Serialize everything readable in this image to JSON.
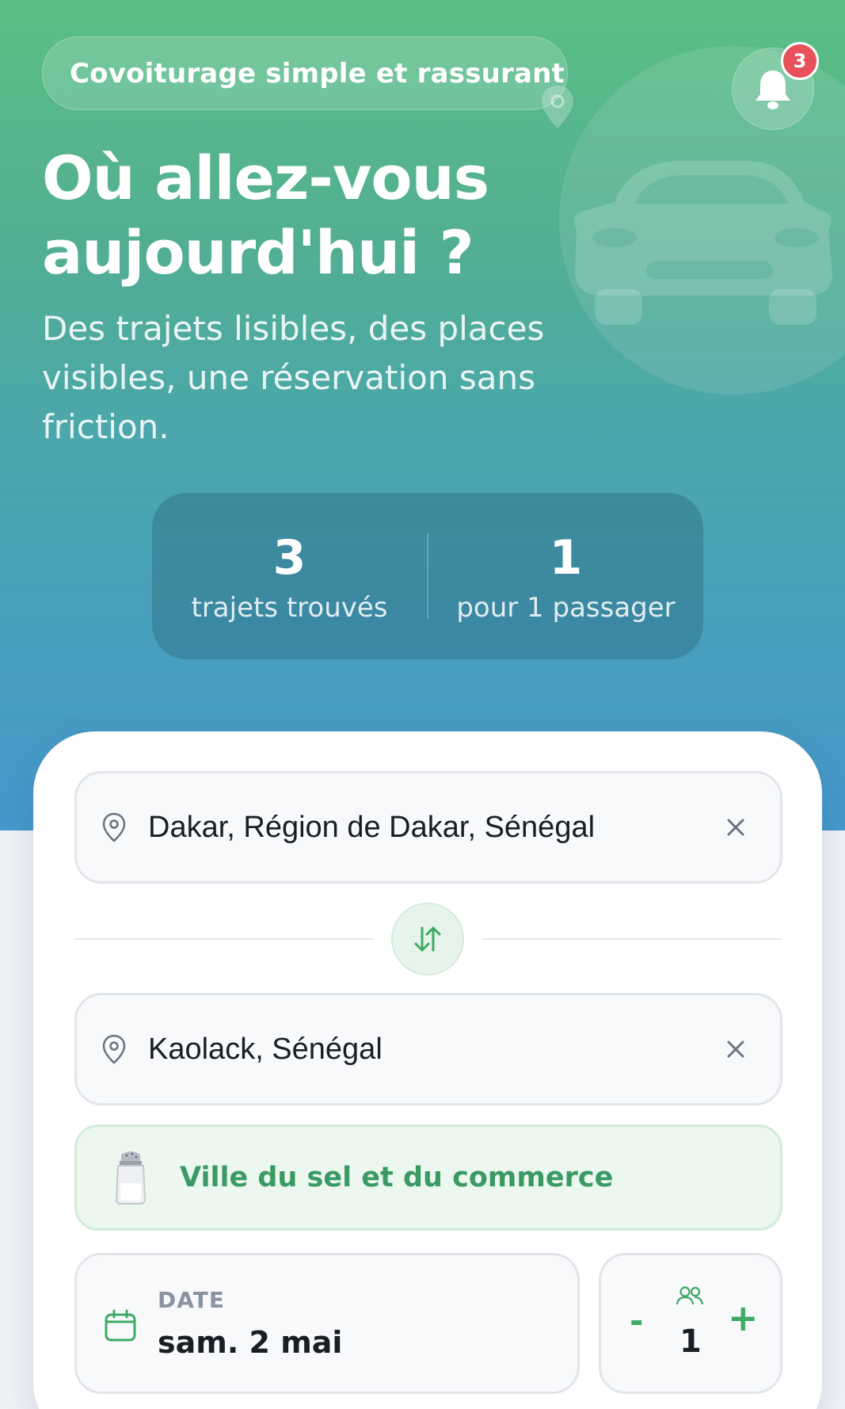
{
  "hero": {
    "tagline": "Covoiturage simple et rassurant",
    "notifications_count": "3",
    "headline_line1": "Où allez-vous",
    "headline_line2": "aujourd'hui ?",
    "subtitle": "Des trajets lisibles, des places visibles, une réservation sans friction.",
    "stats": [
      {
        "value": "3",
        "label": "trajets trouvés"
      },
      {
        "value": "1",
        "label": "pour 1 passager"
      }
    ]
  },
  "search": {
    "departure": "Dakar, Région de Dakar, Sénégal",
    "arrival": "Kaolack, Sénégal",
    "destination_hint": "Ville du sel et du commerce",
    "date_label": "DATE",
    "date_value": "sam. 2 mai",
    "passengers": "1",
    "minus_label": "-",
    "plus_label": "+"
  },
  "colors": {
    "gradient_top": "#5bbf83",
    "gradient_bottom": "#4697cc",
    "accent_green": "#3eaa64",
    "badge_red": "#e8505b"
  },
  "icons": [
    "car-icon",
    "map-pin-icon",
    "bell-icon",
    "location-pin-icon",
    "clear-icon",
    "swap-icon",
    "salt-shaker-icon",
    "calendar-icon",
    "people-icon"
  ]
}
